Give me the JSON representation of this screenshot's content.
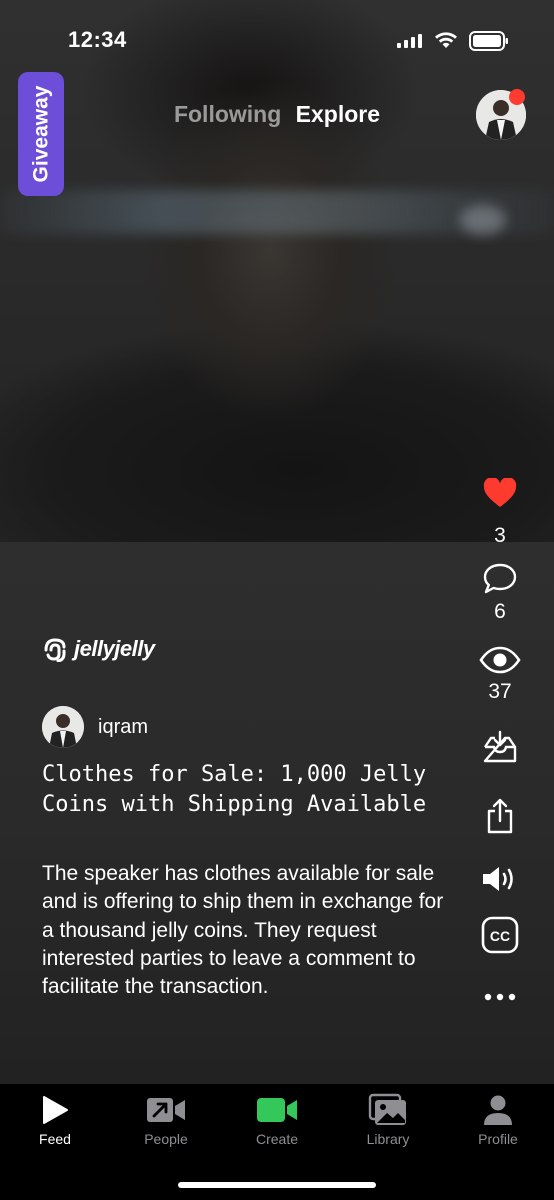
{
  "status_bar": {
    "time": "12:34"
  },
  "header": {
    "giveaway_label": "Giveaway",
    "tabs": [
      {
        "label": "Following",
        "active": false
      },
      {
        "label": "Explore",
        "active": true
      }
    ],
    "profile_has_notification": true
  },
  "actions": {
    "likes": "3",
    "comments": "6",
    "views": "37",
    "like_color": "#ff3b30"
  },
  "brand": {
    "name": "jellyjelly"
  },
  "post": {
    "author": "iqram",
    "title": "Clothes for Sale: 1,000 Jelly Coins with Shipping Available",
    "description": "The speaker has clothes available for sale and is offering to ship them in exchange for a thousand jelly coins. They request interested parties to leave a comment to facilitate the transaction."
  },
  "tabbar": {
    "items": [
      {
        "label": "Feed",
        "icon": "play-icon",
        "active": true
      },
      {
        "label": "People",
        "icon": "people-video-icon",
        "active": false
      },
      {
        "label": "Create",
        "icon": "camera-icon",
        "active": false
      },
      {
        "label": "Library",
        "icon": "library-icon",
        "active": false
      },
      {
        "label": "Profile",
        "icon": "person-icon",
        "active": false
      }
    ],
    "create_color": "#34c759"
  }
}
